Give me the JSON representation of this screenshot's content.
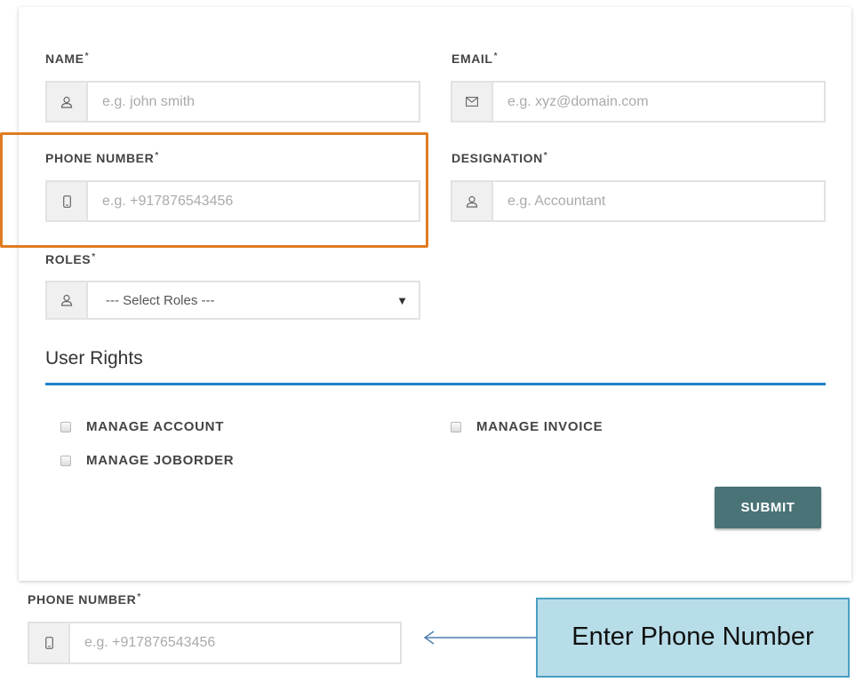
{
  "form": {
    "name": {
      "label": "NAME",
      "required_mark": "*",
      "placeholder": "e.g. john smith",
      "icon": "user-icon"
    },
    "email": {
      "label": "EMAIL",
      "required_mark": "*",
      "placeholder": "e.g. xyz@domain.com",
      "icon": "envelope-icon"
    },
    "phone": {
      "label": "PHONE NUMBER",
      "required_mark": "*",
      "placeholder": "e.g. +917876543456",
      "icon": "mobile-icon"
    },
    "designation": {
      "label": "DESIGNATION",
      "required_mark": "*",
      "placeholder": "e.g. Accountant",
      "icon": "user-icon"
    },
    "roles": {
      "label": "ROLES",
      "required_mark": "*",
      "selected": "--- Select Roles ---",
      "icon": "user-icon"
    }
  },
  "user_rights": {
    "title": "User Rights",
    "options": [
      {
        "label": "MANAGE ACCOUNT",
        "checked": false
      },
      {
        "label": "MANAGE INVOICE",
        "checked": false
      },
      {
        "label": "MANAGE JOBORDER",
        "checked": false
      }
    ]
  },
  "submit_label": "SUBMIT",
  "zoom": {
    "label": "PHONE NUMBER",
    "required_mark": "*",
    "placeholder": "e.g. +917876543456"
  },
  "callout": {
    "text": "Enter Phone Number"
  },
  "colors": {
    "highlight": "#e07b21",
    "rule": "#1f82c8",
    "submit": "#4a7377",
    "callout_bg": "#b7dde8",
    "callout_border": "#4a9ec2"
  }
}
